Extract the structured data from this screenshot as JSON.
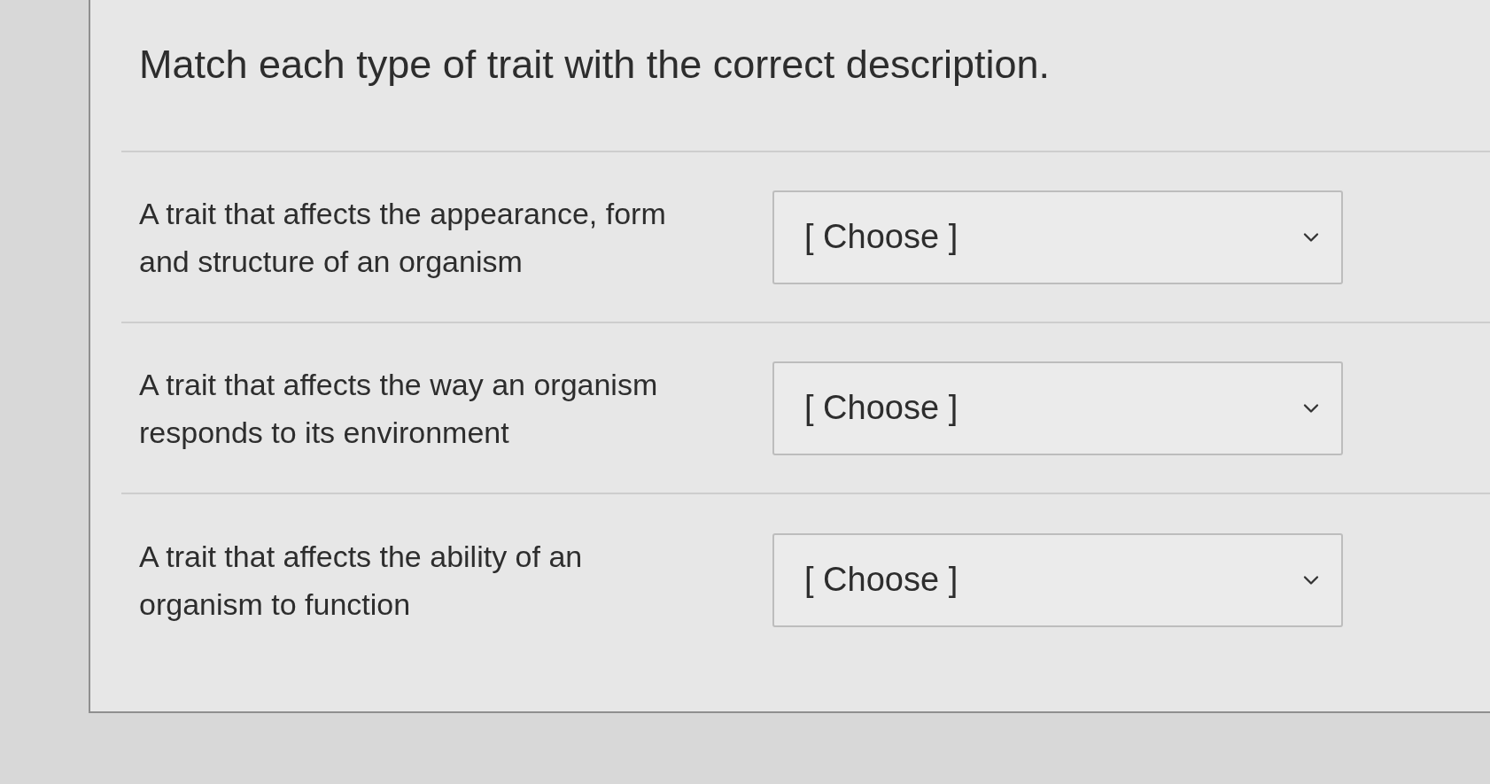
{
  "question": {
    "prompt": "Match each type of trait with the correct description."
  },
  "items": [
    {
      "description": "A trait that affects the appearance, form and structure of an organism",
      "dropdown": {
        "placeholder": "[ Choose ]"
      }
    },
    {
      "description": "A trait that affects the way an organism responds to its environment",
      "dropdown": {
        "placeholder": "[ Choose ]"
      }
    },
    {
      "description": "A trait that affects the ability of an organism to function",
      "dropdown": {
        "placeholder": "[ Choose ]"
      }
    }
  ]
}
